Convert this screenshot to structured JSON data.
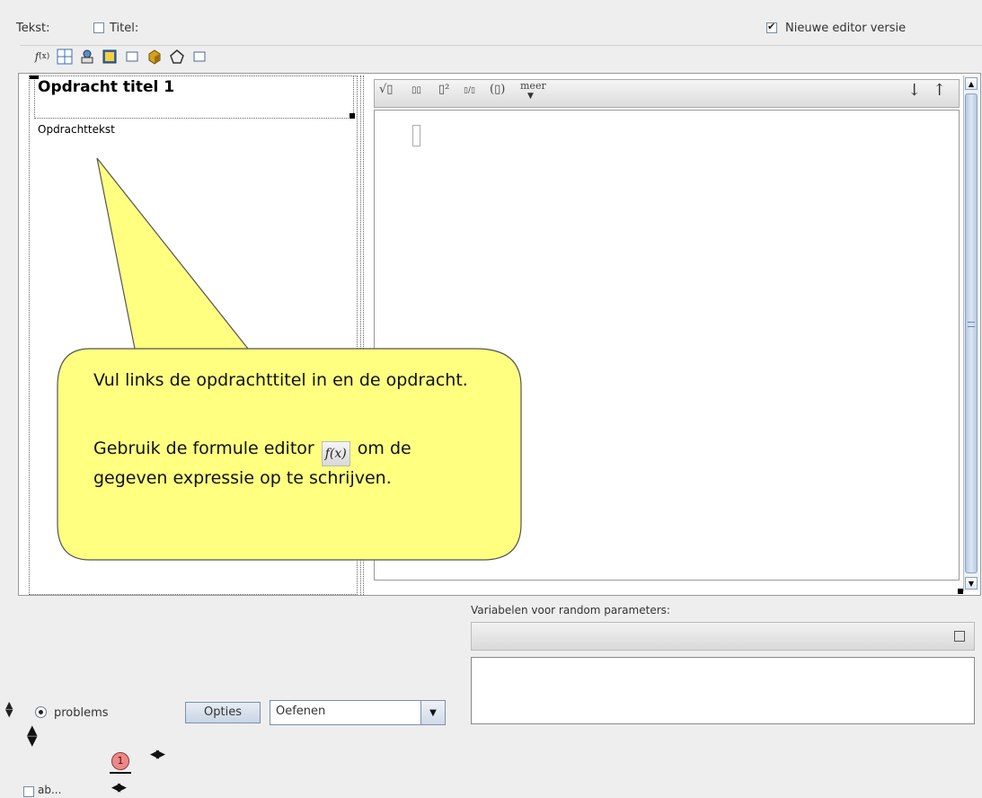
{
  "header": {
    "tekst_label": "Tekst:",
    "titel_label": "Titel:",
    "titel_checked": false,
    "editor_version_label": "Nieuwe editor versie",
    "editor_version_checked": true
  },
  "toolbar": {
    "icons": [
      "formula-icon",
      "table-icon",
      "graph-icon",
      "image-icon",
      "frame-icon",
      "cube-icon",
      "polygon-icon",
      "box-icon"
    ]
  },
  "left_panel": {
    "title": "Opdracht titel 1",
    "body": "Opdrachttekst"
  },
  "math_toolbar": {
    "sqrt": "√▯",
    "power": "▯▯",
    "square": "▯²",
    "fraction": "▯/▯",
    "parens": "(▯)",
    "more": "meer",
    "down": "↓",
    "up": "↑"
  },
  "callout": {
    "line1": "Vul links de opdrachttitel in en de opdracht.",
    "line2_before": "Gebruik de formule editor",
    "line2_after": "om de gegeven expressie op te schrijven.",
    "icon_text": "f(x)"
  },
  "variables": {
    "label": "Variabelen voor random parameters:"
  },
  "bottom": {
    "radio_label": "problems",
    "options_button": "Opties",
    "mode_select": "Oefenen",
    "counter": "1",
    "checkbox_label": "ab..."
  },
  "colors": {
    "callout_fill": "#ffff80",
    "scrollbar": "#c7d6ea",
    "counter_badge": "#e88a8a"
  }
}
